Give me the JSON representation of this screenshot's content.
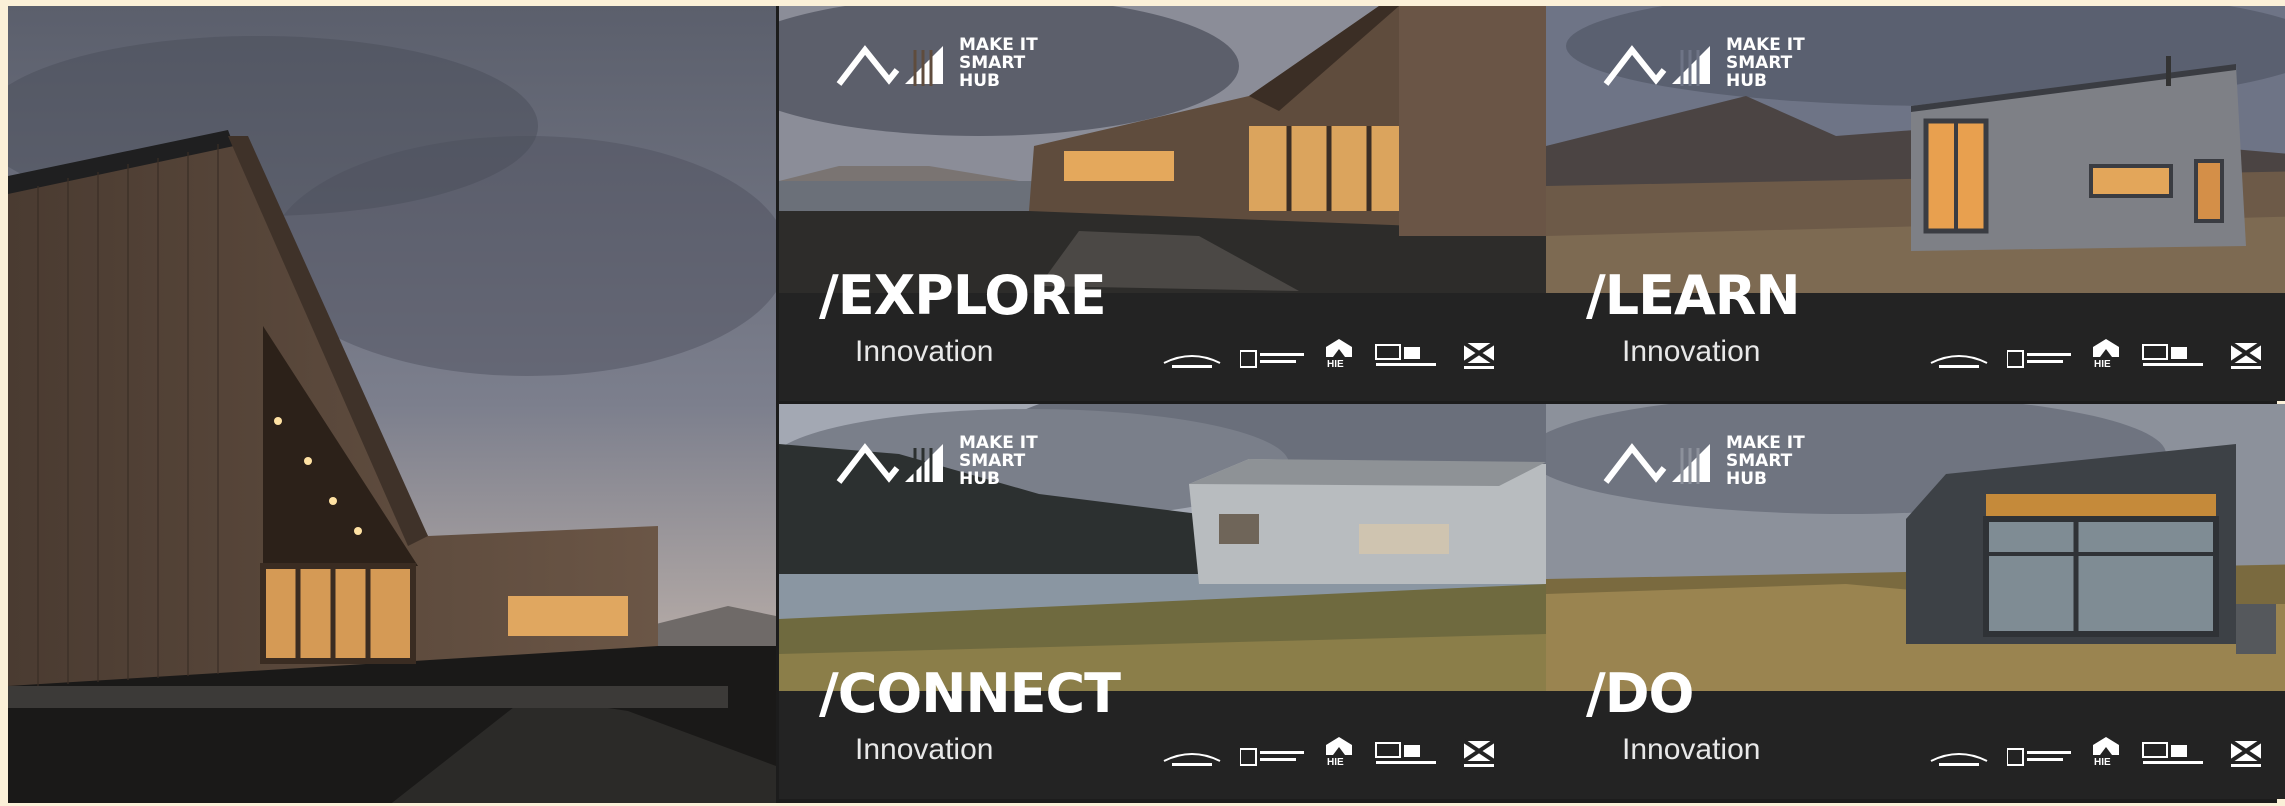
{
  "tiles": [
    {
      "heading": "/EXPLORE",
      "sub": "Innovation"
    },
    {
      "heading": "/LEARN",
      "sub": "Innovation"
    },
    {
      "heading": "/CONNECT",
      "sub": "Innovation"
    },
    {
      "heading": "/DO",
      "sub": "Innovation"
    }
  ],
  "brand": {
    "logo_text": "MAKE IT SMART HUB",
    "logo_icon": "mountain-bars-logo"
  },
  "partners": {
    "hie_label": "HIE"
  },
  "colors": {
    "page_border": "#fbf0d8",
    "caption_bar": "#232323",
    "text": "#ffffff",
    "timber": "#5e4b3d",
    "window_glow": "#f2b860",
    "sky": "#6f7585",
    "grass": "#8a7a46"
  }
}
